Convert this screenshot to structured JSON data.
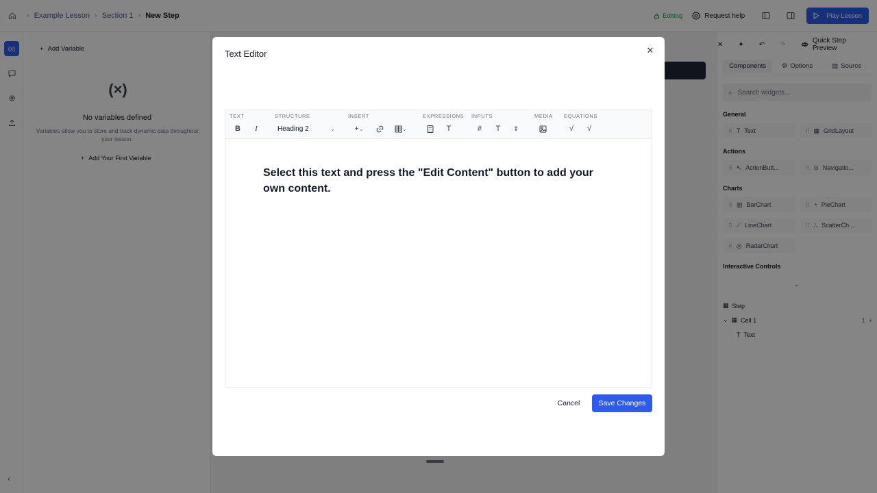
{
  "breadcrumb": {
    "items": [
      "Example Lesson",
      "Section 1"
    ],
    "current": "New Step"
  },
  "header": {
    "status": "Editing",
    "help": "Request help",
    "play": "Play Lesson"
  },
  "variables": {
    "add": "Add Variable",
    "empty_title": "No variables defined",
    "empty_desc": "Variables allow you to store and track dynamic data throughout your lesson.",
    "add_first": "Add Your First Variable"
  },
  "right_panel": {
    "preview": "Quick Step Preview",
    "tabs": [
      "Components",
      "Options",
      "Source"
    ],
    "search_placeholder": "Search widgets...",
    "sections": [
      {
        "title": "General",
        "items": [
          "Text",
          "GridLayout"
        ]
      },
      {
        "title": "Actions",
        "items": [
          "ActionButt...",
          "Navigatio..."
        ]
      },
      {
        "title": "Charts",
        "items": [
          "BarChart",
          "PieChart",
          "LineChart",
          "ScatterCh...",
          "RadarChart"
        ]
      },
      {
        "title": "Interactive Controls",
        "items": []
      }
    ],
    "tree": {
      "step": "Step",
      "cell": "Cell 1",
      "cell_count": "1",
      "text": "Text"
    }
  },
  "modal": {
    "title": "Text Editor",
    "toolbar_groups": [
      "TEXT",
      "STRUCTURE",
      "INSERT",
      "EXPRESSIONS",
      "INPUTS",
      "MEDIA",
      "EQUATIONS"
    ],
    "heading_select": "Heading 2",
    "content": "Select this text and press the \"Edit Content\" button to add your own content.",
    "cancel": "Cancel",
    "save": "Save Changes"
  },
  "colors": {
    "accent": "#2f5bea",
    "editing": "#16a34a"
  }
}
